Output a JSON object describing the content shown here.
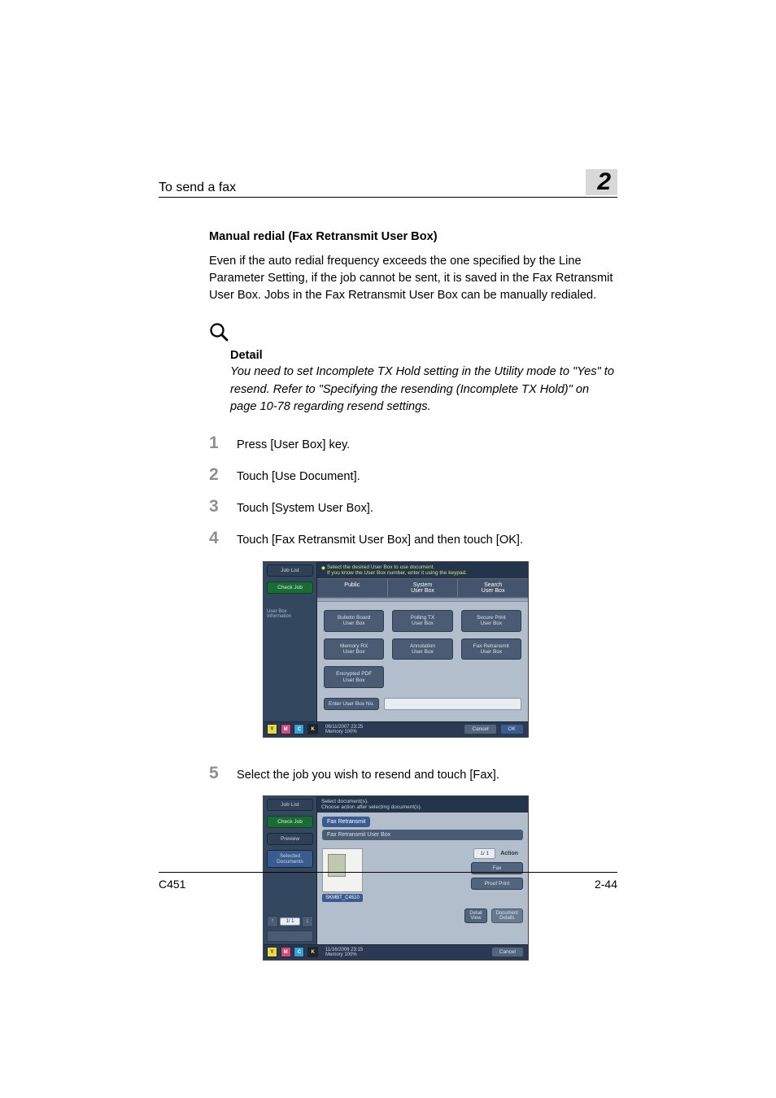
{
  "header": {
    "left": "To send a fax",
    "chapter": "2"
  },
  "section_title": "Manual redial (Fax Retransmit User Box)",
  "intro": "Even if the auto redial frequency exceeds the one specified by the Line Parameter Setting, if the job cannot be sent, it is saved in the Fax Retransmit User Box. Jobs in the Fax Retransmit User Box can be manually redialed.",
  "detail": {
    "heading": "Detail",
    "body": "You need to set Incomplete TX Hold setting in the Utility mode to \"Yes\" to resend. Refer to \"Specifying the resending (Incomplete TX Hold)\" on page 10-78 regarding resend settings."
  },
  "steps": [
    {
      "n": "1",
      "t": "Press [User Box] key."
    },
    {
      "n": "2",
      "t": "Touch [Use Document]."
    },
    {
      "n": "3",
      "t": "Touch [System User Box]."
    },
    {
      "n": "4",
      "t": "Touch [Fax Retransmit User Box] and then touch [OK]."
    },
    {
      "n": "5",
      "t": "Select the job you wish to resend and touch [Fax]."
    }
  ],
  "ss1": {
    "side": {
      "job_list": "Job List",
      "check_job": "Check Job",
      "info": "User Box\nInformation"
    },
    "hint": "Select the desired User Box to use document.\nIf you know the User Box number, enter it using the keypad.",
    "tabs": [
      "Public",
      "System\nUser Box",
      "Search\nUser Box"
    ],
    "tiles": [
      "Bulletin Board\nUser Box",
      "Polling TX\nUser Box",
      "Secure Print\nUser Box",
      "Memory RX\nUser Box",
      "Annotation\nUser Box",
      "Fax Retransmit\nUser Box",
      "Encrypted PDF\nUser Box"
    ],
    "enter": "Enter User Box No.",
    "foot_date": "06/11/2007    23:25\nMemory         100%",
    "cancel": "Cancel",
    "ok": "OK"
  },
  "ss2": {
    "side": {
      "job_list": "Job List",
      "check_job": "Check Job",
      "preview": "Preview",
      "selected": "Selected Documents",
      "page": "1/  1"
    },
    "header": "Select document(s).\nChoose action after selecting document(s).",
    "crumb": "Fax Retransmit",
    "sub": "Fax Retransmit User Box",
    "thumb": "SKMBT_C4510",
    "page": "1/  1",
    "action": "Action",
    "fax": "Fax",
    "proof": "Proof Print",
    "detail": "Detail\nView",
    "docdet": "Document\nDetails",
    "foot_date": "11/16/2006    23:15\nMemory         100%",
    "cancel": "Cancel"
  },
  "footer": {
    "left": "C451",
    "right": "2-44"
  }
}
